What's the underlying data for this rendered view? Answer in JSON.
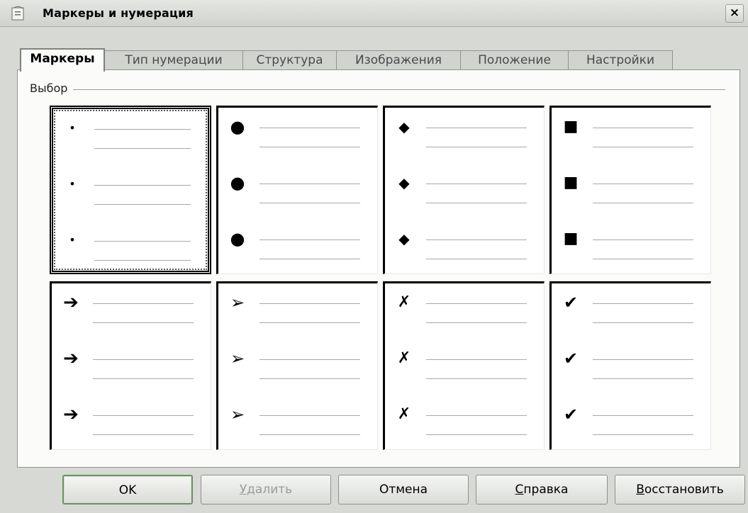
{
  "window": {
    "title": "Маркеры и нумерация",
    "close_glyph": "×"
  },
  "tabs": [
    {
      "label": "Маркеры",
      "active": true
    },
    {
      "label": "Тип нумерации",
      "active": false
    },
    {
      "label": "Структура",
      "active": false
    },
    {
      "label": "Изображения",
      "active": false
    },
    {
      "label": "Положение",
      "active": false
    },
    {
      "label": "Настройки",
      "active": false
    }
  ],
  "selection": {
    "group_label": "Выбор",
    "selected_index": 0,
    "options": [
      {
        "name": "small-dot",
        "glyph": "•"
      },
      {
        "name": "large-dot",
        "glyph": "●"
      },
      {
        "name": "diamond",
        "glyph": "◆"
      },
      {
        "name": "square",
        "glyph": "■"
      },
      {
        "name": "arrow",
        "glyph": "➔"
      },
      {
        "name": "arrowhead",
        "glyph": "➢"
      },
      {
        "name": "cross",
        "glyph": "✗"
      },
      {
        "name": "checkmark",
        "glyph": "✔"
      }
    ]
  },
  "buttons": {
    "ok": "OK",
    "delete_rest": "далить",
    "delete_mnemonic": "У",
    "cancel": "Отмена",
    "help_mnemonic": "С",
    "help_rest": "правка",
    "reset_mnemonic": "В",
    "reset_rest": "осстановить"
  },
  "colors": {
    "background": "#d6d9d4",
    "panel": "#fbfbfa",
    "default_button_border": "#6f8f6a"
  }
}
